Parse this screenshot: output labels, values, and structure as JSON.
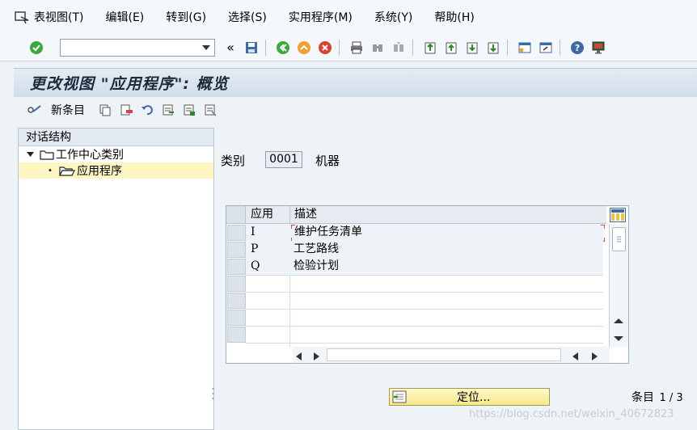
{
  "menu": {
    "items": [
      "表视图(T)",
      "编辑(E)",
      "转到(G)",
      "选择(S)",
      "实用程序(M)",
      "系统(Y)",
      "帮助(H)"
    ]
  },
  "toolbar": {
    "command_value": "",
    "back_symbol": "«"
  },
  "title": "更改视图 \"应用程序\": 概览",
  "app_toolbar": {
    "new_entries_label": "新条目"
  },
  "left_panel": {
    "header": "对话结构",
    "tree": [
      {
        "label": "工作中心类别",
        "expanded": true
      },
      {
        "label": "应用程序",
        "selected": true
      }
    ]
  },
  "category": {
    "label": "类别",
    "value": "0001",
    "description": "机器"
  },
  "table": {
    "columns": [
      "应用",
      "描述"
    ],
    "rows": [
      {
        "app": "I",
        "desc": "维护任务清单"
      },
      {
        "app": "P",
        "desc": "工艺路线"
      },
      {
        "app": "Q",
        "desc": "检验计划"
      }
    ]
  },
  "position_button": "定位...",
  "entries": {
    "label": "条目",
    "value": "1 / 3"
  },
  "watermark": "https://blog.csdn.net/weixin_40672823",
  "colors": {
    "accent_green": "#3aa83a",
    "selected_row": "#fdf6c3",
    "button_yellow": "#f5e88a"
  }
}
